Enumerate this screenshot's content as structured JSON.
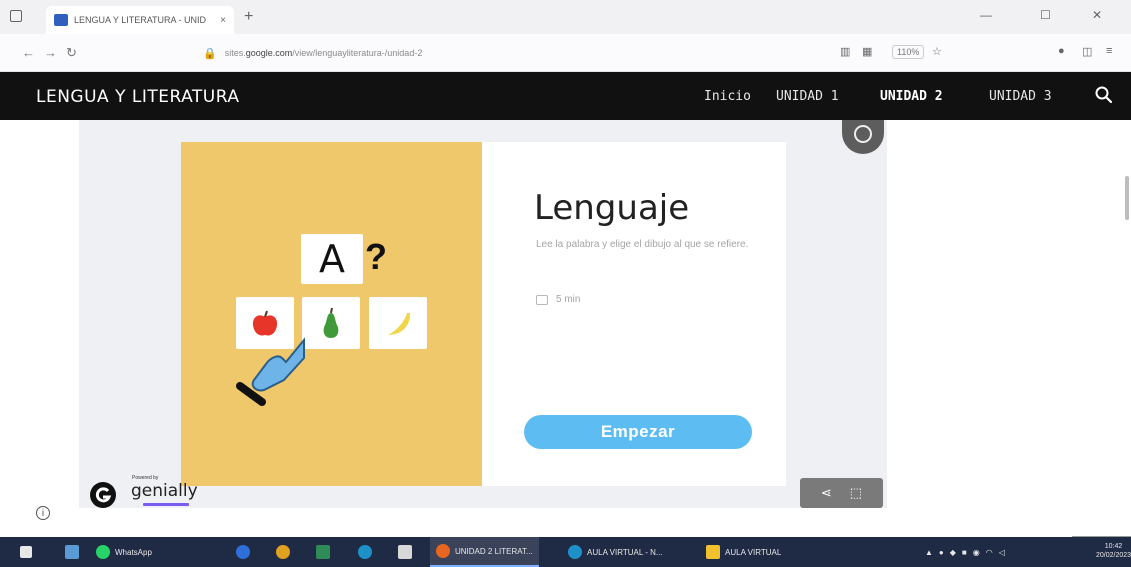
{
  "browser": {
    "tab_title": "LENGUA Y LITERATURA - UNID",
    "tab_close": "×",
    "new_tab": "+",
    "back": "←",
    "forward": "→",
    "refresh": "↻",
    "url_prefix": "sites.",
    "url_domain": "google.com",
    "url_rest": "/view/lenguayliteratura-/unidad-2",
    "zoom": "110%",
    "window_min": "—",
    "window_max": "☐",
    "window_close": "✕"
  },
  "site": {
    "title": "LENGUA Y LITERATURA",
    "nav": [
      "Inicio",
      "UNIDAD 1",
      "UNIDAD 2",
      "UNIDAD 3"
    ],
    "active_nav_index": 2
  },
  "activity": {
    "letter": "A",
    "question_mark": "?",
    "heading": "Lenguaje",
    "description": "Lee la palabra y elige el dibujo al que se refiere.",
    "time": "5 min",
    "start_button": "Empezar",
    "powered_by": "Powered by",
    "brand": "genially"
  },
  "taskbar": {
    "items": [
      "WhatsApp",
      "UNIDAD 2 LITERAT...",
      "AULA VIRTUAL - N...",
      "AULA VIRTUAL"
    ],
    "clock_time": "10:42",
    "clock_date": "20/02/2023"
  },
  "colors": {
    "header_bg": "#111111",
    "yellow_panel": "#efc86b",
    "start_button": "#5dbdf2",
    "taskbar": "#1f2a44",
    "brand_accent": "#7a5cf0"
  }
}
